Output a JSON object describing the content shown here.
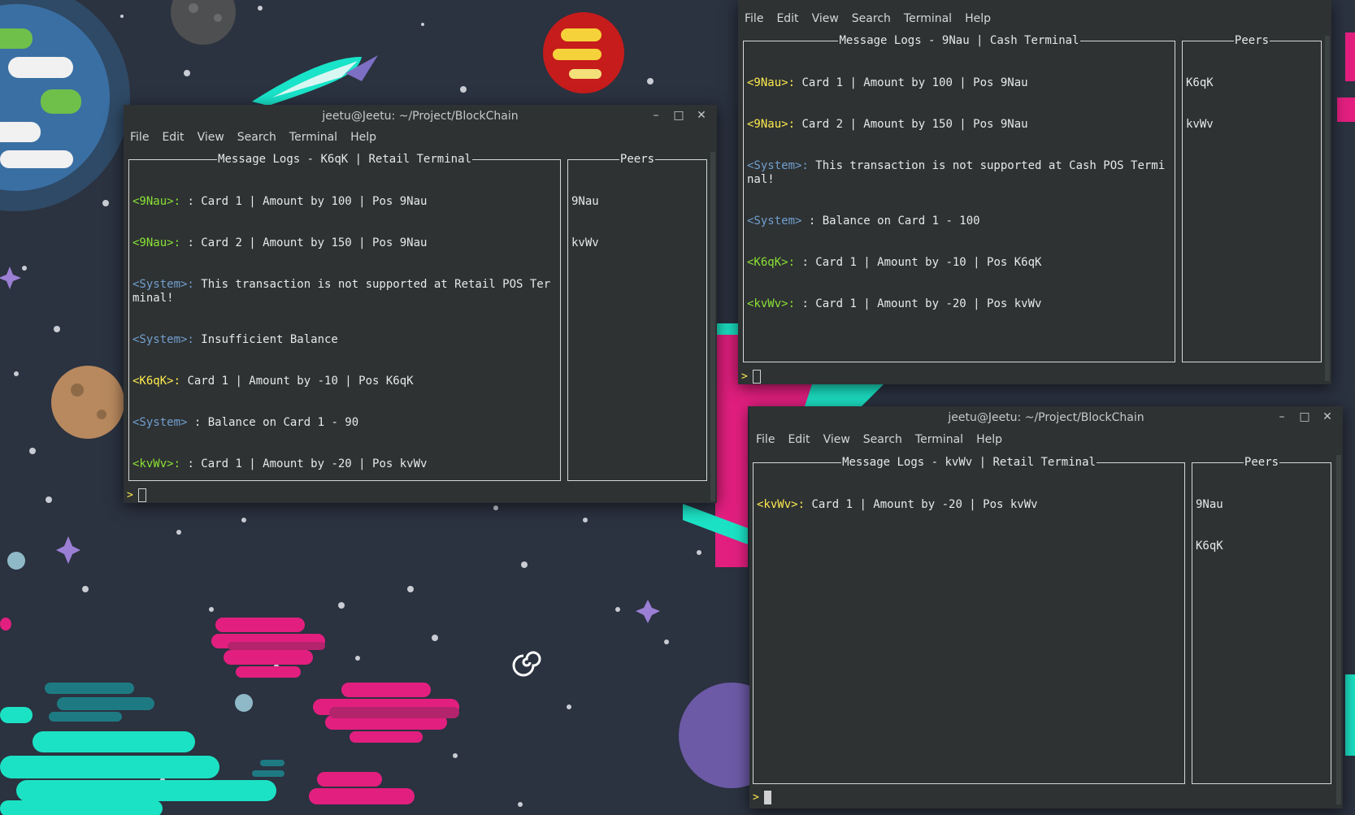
{
  "window_controls": {
    "minimize": "–",
    "maximize": "□",
    "close": "✕"
  },
  "menu": [
    "File",
    "Edit",
    "View",
    "Search",
    "Terminal",
    "Help"
  ],
  "terminals": [
    {
      "title": "jeetu@Jeetu: ~/Project/BlockChain",
      "log_title": "Message Logs - K6qK | Retail Terminal",
      "peers_title": "Peers",
      "log": [
        {
          "tag": "<9Nau>:",
          "color": "green",
          "text": " : Card 1 | Amount by 100 | Pos 9Nau"
        },
        {
          "tag": "<9Nau>:",
          "color": "green",
          "text": " : Card 2 | Amount by 150 | Pos 9Nau"
        },
        {
          "tag": "<System>:",
          "color": "blue",
          "text": " This transaction is not supported at Retail POS Terminal!"
        },
        {
          "tag": "<System>:",
          "color": "blue",
          "text": " Insufficient Balance"
        },
        {
          "tag": "<K6qK>:",
          "color": "yellow",
          "text": " Card 1 | Amount by -10 | Pos K6qK"
        },
        {
          "tag": "<System>",
          "color": "blue",
          "text": " : Balance on Card 1 - 90"
        },
        {
          "tag": "<kvWv>:",
          "color": "green",
          "text": " : Card 1 | Amount by -20 | Pos kvWv"
        }
      ],
      "peers": [
        "9Nau",
        "kvWv"
      ],
      "prompt": ">"
    },
    {
      "title": "",
      "log_title": "Message Logs - 9Nau | Cash Terminal",
      "peers_title": "Peers",
      "log": [
        {
          "tag": "<9Nau>:",
          "color": "yellow",
          "text": " Card 1 | Amount by 100 | Pos 9Nau"
        },
        {
          "tag": "<9Nau>:",
          "color": "yellow",
          "text": " Card 2 | Amount by 150 | Pos 9Nau"
        },
        {
          "tag": "<System>:",
          "color": "blue",
          "text": " This transaction is not supported at Cash POS Terminal!"
        },
        {
          "tag": "<System>",
          "color": "blue",
          "text": " : Balance on Card 1 - 100"
        },
        {
          "tag": "<K6qK>:",
          "color": "green",
          "text": " : Card 1 | Amount by -10 | Pos K6qK"
        },
        {
          "tag": "<kvWv>:",
          "color": "green",
          "text": " : Card 1 | Amount by -20 | Pos kvWv"
        }
      ],
      "peers": [
        "K6qK",
        "kvWv"
      ],
      "prompt": ">"
    },
    {
      "title": "jeetu@Jeetu: ~/Project/BlockChain",
      "log_title": "Message Logs - kvWv | Retail Terminal",
      "peers_title": "Peers",
      "log": [
        {
          "tag": "<kvWv>:",
          "color": "yellow",
          "text": " Card 1 | Amount by -20 | Pos kvWv"
        }
      ],
      "peers": [
        "9Nau",
        "K6qK"
      ],
      "prompt": ">"
    }
  ]
}
